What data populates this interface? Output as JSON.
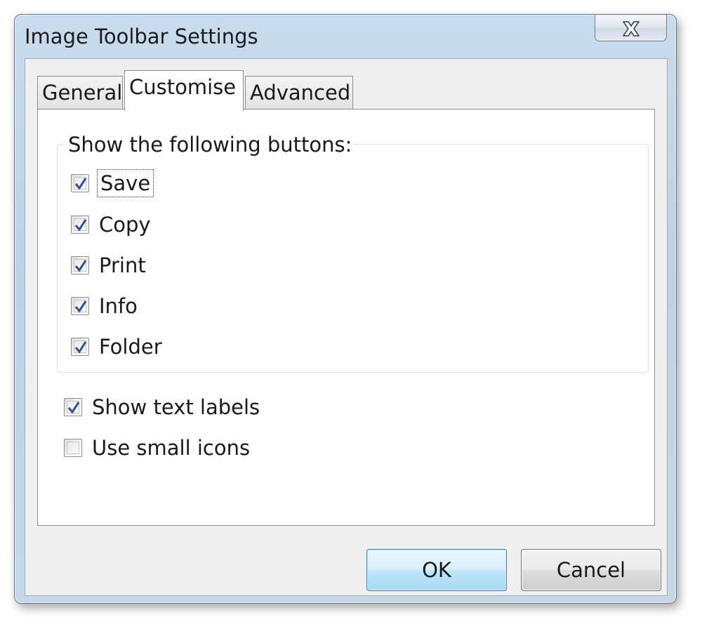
{
  "window": {
    "title": "Image Toolbar Settings",
    "close_icon": "close-x-icon"
  },
  "tabs": [
    {
      "label": "General",
      "active": false
    },
    {
      "label": "Customise",
      "active": true
    },
    {
      "label": "Advanced",
      "active": false
    }
  ],
  "group": {
    "legend": "Show the following buttons:",
    "items": [
      {
        "label": "Save",
        "checked": true,
        "focused": true
      },
      {
        "label": "Copy",
        "checked": true
      },
      {
        "label": "Print",
        "checked": true
      },
      {
        "label": "Info",
        "checked": true
      },
      {
        "label": "Folder",
        "checked": true
      }
    ]
  },
  "options": [
    {
      "label": "Show text labels",
      "checked": true
    },
    {
      "label": "Use small icons",
      "checked": false
    }
  ],
  "buttons": {
    "ok": "OK",
    "cancel": "Cancel"
  },
  "colors": {
    "frame": "#bcd3e7",
    "check_mark": "#2f4ea3",
    "default_button": "#bee6fd"
  }
}
